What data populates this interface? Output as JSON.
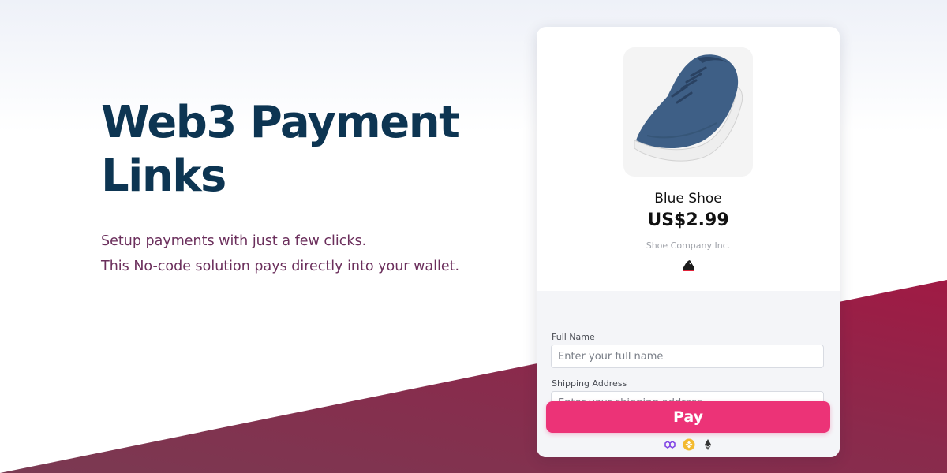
{
  "hero": {
    "title": "Web3 Payment Links",
    "subtitle_lines": [
      "Setup payments with just a few clicks.",
      "This No-code solution pays directly into your wallet."
    ]
  },
  "product": {
    "image_icon": "blue-sneaker-image",
    "name": "Blue Shoe",
    "price": "US$2.99",
    "seller": "Shoe Company Inc.",
    "seller_logo_icon": "sneaker-logo-icon"
  },
  "form": {
    "full_name_label": "Full Name",
    "full_name_placeholder": "Enter your full name",
    "full_name_value": "",
    "address_label": "Shipping Address",
    "address_placeholder": "Enter your shipping address",
    "address_value": "",
    "pay_label": "Pay"
  },
  "currency_icons": [
    "polygon-icon",
    "binance-icon",
    "ethereum-icon"
  ],
  "colors": {
    "title": "#0d3552",
    "subtitle": "#6b2f5c",
    "pay_button": "#ec3377",
    "diagonal_start": "#7a3a52",
    "diagonal_end": "#a01a44"
  }
}
